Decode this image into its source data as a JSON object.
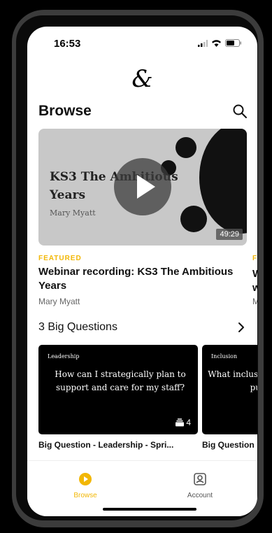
{
  "status_bar": {
    "time": "16:53"
  },
  "header": {
    "logo": "&",
    "title": "Browse"
  },
  "featured_card": {
    "thumbnail_title": "KS3 The Ambitious Years",
    "thumbnail_author": "Mary Myatt",
    "duration": "49:29",
    "badge": "FEATURED",
    "title": "Webinar recording: KS3 The Ambitious Years",
    "author": "Mary Myatt"
  },
  "next_card_peek": {
    "badge": "F",
    "title": "W\nw",
    "author": "M"
  },
  "big_questions": {
    "section_title": "3 Big Questions",
    "items": [
      {
        "tag": "Leadership",
        "question": "How can I strategically plan to support and care for my staff?",
        "count": "4",
        "label": "Big Question - Leadership - Spri..."
      },
      {
        "tag": "Inclusion",
        "question": "What inclusi pu",
        "count": "",
        "label": "Big Question"
      }
    ]
  },
  "tab_bar": {
    "tabs": [
      {
        "label": "Browse",
        "active": true
      },
      {
        "label": "Account",
        "active": false
      }
    ]
  },
  "colors": {
    "accent": "#f2b705",
    "dark": "#000000"
  },
  "icons": [
    "search-icon",
    "play-icon",
    "chevron-right-icon",
    "stack-icon",
    "browse-tab-icon",
    "account-tab-icon",
    "signal-icon",
    "wifi-icon",
    "battery-icon"
  ]
}
